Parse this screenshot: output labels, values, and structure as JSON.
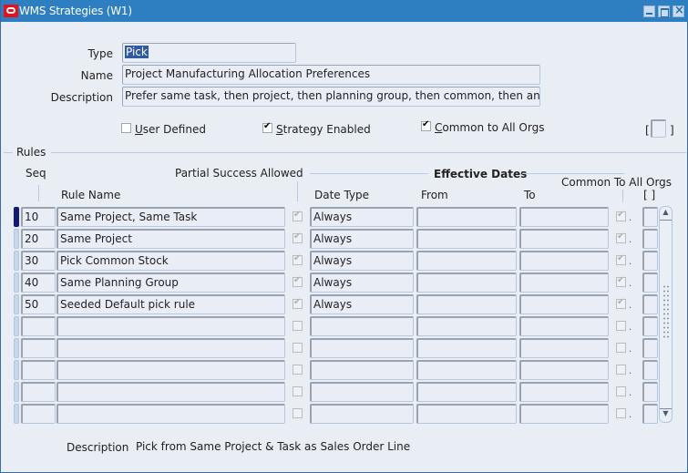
{
  "window": {
    "title": "WMS Strategies (W1)",
    "buttons": [
      "minimize",
      "maximize",
      "close"
    ]
  },
  "header": {
    "type_label": "Type",
    "type_value": "Pick",
    "name_label": "Name",
    "name_value": "Project Manufacturing Allocation Preferences",
    "description_label": "Description",
    "description_value": "Prefer same task, then project, then planning group, then common, then anythi",
    "user_defined_label": "User Defined",
    "user_defined_checked": false,
    "strategy_enabled_label": "Strategy Enabled",
    "strategy_enabled_checked": true,
    "common_all_orgs_label": "Common to All Orgs",
    "common_all_orgs_checked": true,
    "flex_left": "[",
    "flex_right": "]"
  },
  "rules": {
    "section_label": "Rules",
    "headers": {
      "seq": "Seq",
      "rule_name": "Rule Name",
      "partial_success": "Partial Success Allowed",
      "effective_dates": "Effective Dates",
      "date_type": "Date Type",
      "from": "From",
      "to": "To",
      "common_all_orgs": "Common To All Orgs",
      "flex": "[ ]"
    },
    "rows": [
      {
        "seq": "10",
        "rule_name": "Same Project, Same Task",
        "partial": true,
        "date_type": "Always",
        "from": "",
        "to": "",
        "common": true,
        "current": true
      },
      {
        "seq": "20",
        "rule_name": "Same Project",
        "partial": true,
        "date_type": "Always",
        "from": "",
        "to": "",
        "common": true,
        "current": false
      },
      {
        "seq": "30",
        "rule_name": "Pick Common Stock",
        "partial": true,
        "date_type": "Always",
        "from": "",
        "to": "",
        "common": true,
        "current": false
      },
      {
        "seq": "40",
        "rule_name": "Same Planning Group",
        "partial": true,
        "date_type": "Always",
        "from": "",
        "to": "",
        "common": true,
        "current": false
      },
      {
        "seq": "50",
        "rule_name": "Seeded Default pick rule",
        "partial": true,
        "date_type": "Always",
        "from": "",
        "to": "",
        "common": true,
        "current": false
      },
      {
        "seq": "",
        "rule_name": "",
        "partial": false,
        "date_type": "",
        "from": "",
        "to": "",
        "common": false,
        "current": false
      },
      {
        "seq": "",
        "rule_name": "",
        "partial": false,
        "date_type": "",
        "from": "",
        "to": "",
        "common": false,
        "current": false
      },
      {
        "seq": "",
        "rule_name": "",
        "partial": false,
        "date_type": "",
        "from": "",
        "to": "",
        "common": false,
        "current": false
      },
      {
        "seq": "",
        "rule_name": "",
        "partial": false,
        "date_type": "",
        "from": "",
        "to": "",
        "common": false,
        "current": false
      },
      {
        "seq": "",
        "rule_name": "",
        "partial": false,
        "date_type": "",
        "from": "",
        "to": "",
        "common": false,
        "current": false
      }
    ]
  },
  "footer": {
    "description_label": "Description",
    "description_value": "Pick from Same Project & Task as Sales Order Line"
  }
}
